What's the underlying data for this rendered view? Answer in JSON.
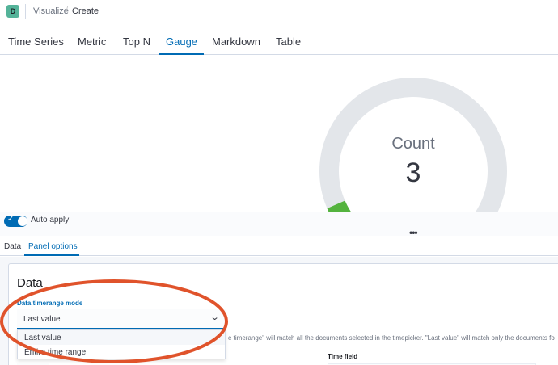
{
  "header": {
    "avatar_letter": "D",
    "breadcrumbs": [
      "Visualize",
      "Create"
    ],
    "breadcrumb_separator": "/"
  },
  "tabs": {
    "items": [
      {
        "label": "Time Series",
        "active": false
      },
      {
        "label": "Metric",
        "active": false
      },
      {
        "label": "Top N",
        "active": false
      },
      {
        "label": "Gauge",
        "active": true
      },
      {
        "label": "Markdown",
        "active": false
      },
      {
        "label": "Table",
        "active": false
      }
    ]
  },
  "gauge": {
    "label": "Count",
    "value": "3",
    "fill_fraction": 0.08,
    "fill_color": "#54b33e",
    "track_color": "#e3e6ea"
  },
  "toolbar": {
    "auto_apply_label": "Auto apply",
    "auto_apply_on": true,
    "more_menu_label": "•••"
  },
  "editor_tabs": {
    "items": [
      {
        "label": "Data",
        "active": false
      },
      {
        "label": "Panel options",
        "active": true
      }
    ]
  },
  "panel": {
    "section_title": "Data",
    "timerange_label": "Data timerange mode",
    "timerange_value": "Last value",
    "chevron": "⌄",
    "options": [
      "Last value",
      "Entire time range"
    ],
    "help_text": "e timerange\" will match all the documents selected in the timepicker. \"Last value\" will match only the documents fo",
    "time_field_label": "Time field"
  },
  "colors": {
    "accent": "#006bb4",
    "annotation": "#e0532b"
  }
}
